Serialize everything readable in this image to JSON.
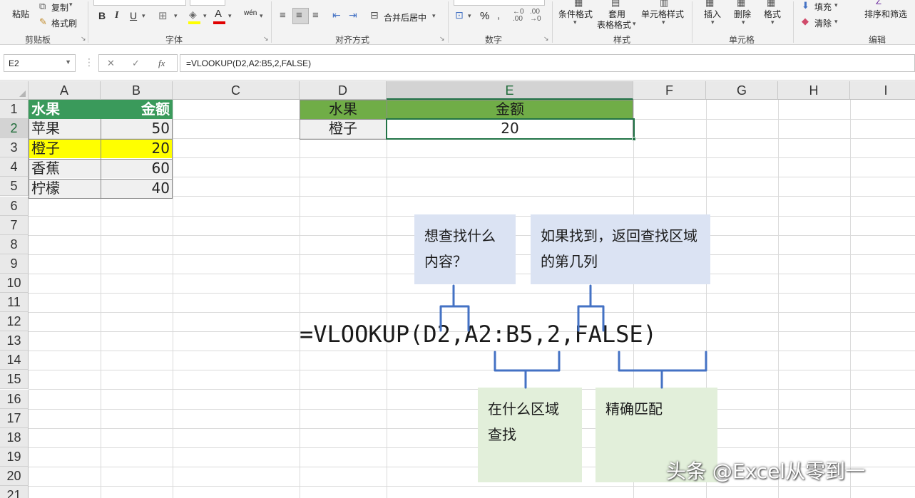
{
  "ribbon": {
    "clipboard": {
      "paste": "粘贴",
      "copy": "复制",
      "format_painter": "格式刷",
      "group": "剪贴板"
    },
    "font": {
      "bold": "B",
      "italic": "I",
      "underline": "U",
      "group": "字体",
      "pinyin": "wén"
    },
    "alignment": {
      "merge": "合并后居中",
      "group": "对齐方式"
    },
    "number": {
      "percent": "%",
      "group": "数字"
    },
    "styles": {
      "conditional": "条件格式",
      "table_format_1": "套用",
      "table_format_2": "表格格式",
      "cell_styles": "单元格样式",
      "group": "样式"
    },
    "cells": {
      "insert": "插入",
      "delete": "删除",
      "format": "格式",
      "group": "单元格"
    },
    "editing": {
      "fill": "填充",
      "clear": "清除",
      "sort": "排序和筛选",
      "group": "编辑"
    }
  },
  "formula_bar": {
    "name_box": "E2",
    "formula": "=VLOOKUP(D2,A2:B5,2,FALSE)"
  },
  "columns": [
    "A",
    "B",
    "C",
    "D",
    "E",
    "F",
    "G",
    "H",
    "I"
  ],
  "rows": [
    "1",
    "2",
    "3",
    "4",
    "5",
    "6",
    "7",
    "8",
    "9",
    "10",
    "11",
    "12",
    "13",
    "14",
    "15",
    "16",
    "17",
    "18",
    "19",
    "20",
    "21"
  ],
  "source_table": {
    "header": [
      "水果",
      "金额"
    ],
    "rows": [
      [
        "苹果",
        "50"
      ],
      [
        "橙子",
        "20"
      ],
      [
        "香蕉",
        "60"
      ],
      [
        "柠檬",
        "40"
      ]
    ]
  },
  "lookup_table": {
    "header": [
      "水果",
      "金额"
    ],
    "row": [
      "橙子",
      "20"
    ]
  },
  "explanation": {
    "formula": "=VLOOKUP(D2,A2:B5,2,FALSE)",
    "lookup_value_note": "想查找什么内容？",
    "col_index_note": "如果找到，返回查找区域的第几列",
    "range_note": "在什么区域查找",
    "match_note": "精确匹配"
  },
  "watermark": "头条 @Excel从零到一",
  "colors": {
    "header_green": "#3a9a5b",
    "header_light_green": "#70ad47",
    "highlight": "#ffff00",
    "note_blue": "#dbe3f3",
    "note_green": "#e2efda",
    "bracket": "#4472c4"
  }
}
